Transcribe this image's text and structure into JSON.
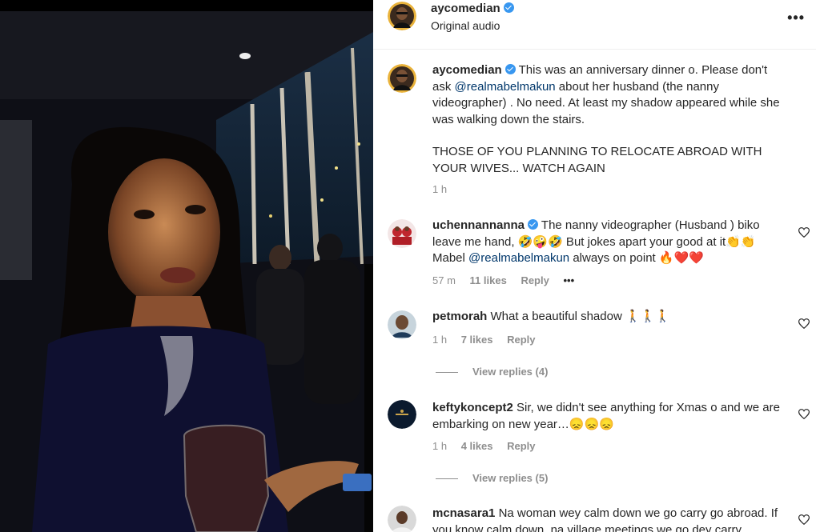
{
  "header": {
    "username": "aycomedian",
    "subtitle": "Original audio",
    "more_icon": "•••"
  },
  "caption": {
    "username": "aycomedian",
    "text_1": "This was an anniversary dinner o. Please don't ask ",
    "mention": "@realmabelmakun",
    "text_2": " about her husband (the nanny videographer) . No need. At least my shadow appeared while she was walking down the stairs.",
    "text_caps": "THOSE OF YOU PLANNING TO RELOCATE ABROAD WITH YOUR WIVES... WATCH AGAIN",
    "time": "1 h"
  },
  "comments": [
    {
      "username": "uchennannanna",
      "text_1": "The nanny videographer (Husband ) biko leave me hand, 🤣🤪🤣 But jokes apart your good at it👏👏 Mabel ",
      "mention": "@realmabelmakun",
      "text_2": " always on point 🔥❤️❤️",
      "time": "57 m",
      "likes": "11 likes",
      "reply": "Reply",
      "more": "•••"
    },
    {
      "username": "petmorah",
      "text_1": "What a beautiful shadow 🚶🚶🚶",
      "time": "1 h",
      "likes": "7 likes",
      "reply": "Reply",
      "view_replies": "View replies (4)"
    },
    {
      "username": "keftykoncept2",
      "text_1": "Sir, we didn't see anything for Xmas o and we are embarking on new year…😞😞😞",
      "time": "1 h",
      "likes": "4 likes",
      "reply": "Reply",
      "view_replies": "View replies (5)"
    },
    {
      "username": "mcnasara1",
      "text_1": "Na woman wey calm down we go carry go abroad. If you know calm down, na village meetings we go dey carry"
    }
  ],
  "colors": {
    "verified": "#3897f0",
    "mention": "#00376b",
    "meta": "#8e8e8e"
  }
}
